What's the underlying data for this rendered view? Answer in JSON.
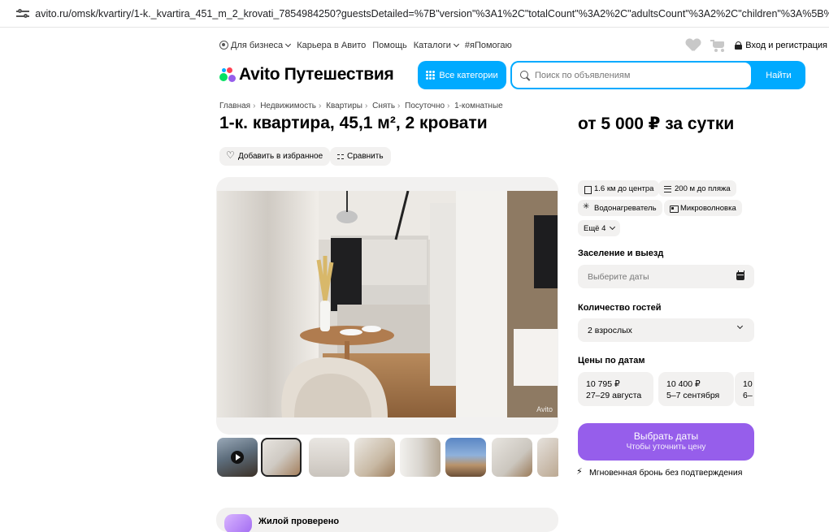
{
  "browser": {
    "url": "avito.ru/omsk/kvartiry/1-k._kvartira_451_m_2_krovati_7854984250?guestsDetailed=%7B\"version\"%3A1%2C\"totalCount\"%3A2%2C\"adultsCount\"%3A2%2C\"children\"%3A%5B%5D%7D"
  },
  "topnav": {
    "business": "Для бизнеса",
    "career": "Карьера в Авито",
    "help": "Помощь",
    "catalogs": "Каталоги",
    "help_tag": "#яПомогаю",
    "login": "Вход и регистрация"
  },
  "header": {
    "logo_text": "Avito Путешествия",
    "categories_label": "Все категории",
    "search_placeholder": "Поиск по объявлениям",
    "search_button": "Найти"
  },
  "breadcrumbs": [
    "Главная",
    "Недвижимость",
    "Квартиры",
    "Снять",
    "Посуточно",
    "1-комнатные"
  ],
  "listing": {
    "title": "1-к. квартира, 45,1 м², 2 кровати",
    "price": "от 5 000 ₽ за сутки",
    "favorite_label": "Добавить в избранное",
    "compare_label": "Сравнить",
    "watermark": "Avito",
    "thumbnail_count": 8,
    "selected_thumbnail": 2
  },
  "features": {
    "items": [
      "1.6 км до центра",
      "200 м до пляжа",
      "Водонагреватель",
      "Микроволновка"
    ],
    "more_label": "Ещё 4"
  },
  "booking": {
    "checkin_label": "Заселение и выезд",
    "dates_placeholder": "Выберите даты",
    "guests_label": "Количество гостей",
    "guests_value": "2 взрослых",
    "prices_label": "Цены по датам",
    "price_cards": [
      {
        "price": "10 795 ₽",
        "dates": "27–29 августа"
      },
      {
        "price": "10 400 ₽",
        "dates": "5–7 сентября"
      },
      {
        "price": "10",
        "dates": "6–"
      }
    ],
    "cta_title": "Выбрать даты",
    "cta_subtitle": "Чтобы уточнить цену",
    "instant_label": "Мгновенная бронь без подтверждения"
  },
  "bottom_card": {
    "label": "Жилой проверено"
  },
  "colors": {
    "accent_blue": "#00aaff",
    "accent_purple": "#965eeb",
    "chip_bg": "#f2f1f0"
  }
}
